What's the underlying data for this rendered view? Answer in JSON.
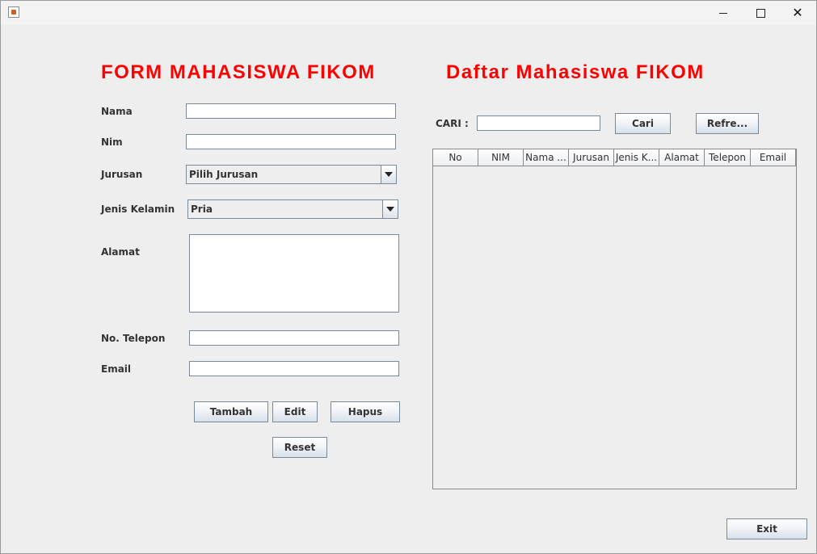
{
  "window": {
    "title": "",
    "minimize_icon": "minimize-icon",
    "maximize_icon": "maximize-icon",
    "close_glyph": "✕"
  },
  "form": {
    "heading": "FORM MAHASISWA FIKOM",
    "nama_label": "Nama",
    "nama_value": "",
    "nim_label": "Nim",
    "nim_value": "",
    "jurusan_label": "Jurusan",
    "jurusan_selected": "Pilih Jurusan",
    "gender_label": "Jenis Kelamin",
    "gender_selected": "Pria",
    "alamat_label": "Alamat",
    "alamat_value": "",
    "telepon_label": "No. Telepon",
    "telepon_value": "",
    "email_label": "Email",
    "email_value": "",
    "tambah_label": "Tambah",
    "edit_label": "Edit",
    "hapus_label": "Hapus",
    "reset_label": "Reset"
  },
  "list": {
    "heading": "Daftar Mahasiswa FIKOM",
    "cari_label": "CARI :",
    "cari_value": "",
    "cari_button": "Cari",
    "refresh_button": "Refre...",
    "columns": [
      "No",
      "NIM",
      "Nama ...",
      "Jurusan",
      "Jenis K...",
      "Alamat",
      "Telepon",
      "Email"
    ],
    "rows": []
  },
  "exit_label": "Exit",
  "colors": {
    "heading": "#ff0000",
    "background": "#eeeeee"
  }
}
